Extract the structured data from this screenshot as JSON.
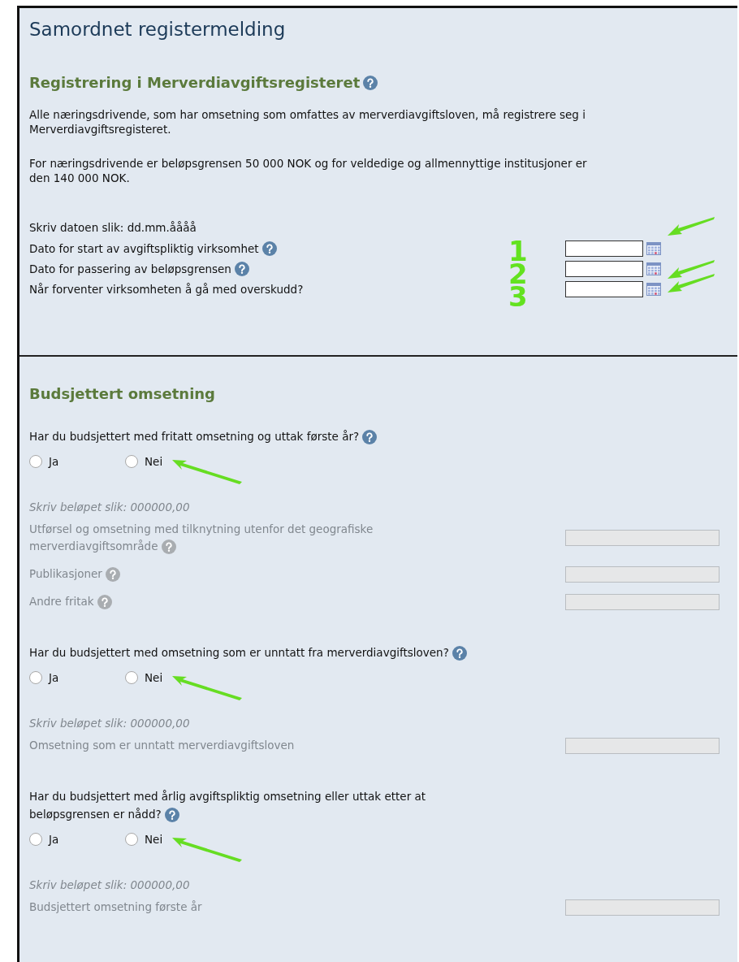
{
  "title": "Samordnet registermelding",
  "registration": {
    "heading": "Registrering i Merverdiavgiftsregisteret",
    "help": true,
    "paragraphs": [
      "Alle næringsdrivende, som har omsetning som omfattes av merverdiavgiftsloven, må registrere seg i Merverdiavgiftsregisteret.",
      "For næringsdrivende er beløpsgrensen 50 000 NOK og for veldedige og allmennyttige institusjoner er den 140 000 NOK."
    ],
    "date_hint": "Skriv datoen slik: dd.mm.åååå",
    "date_fields": [
      {
        "label": "Dato for start av avgiftspliktig virksomhet",
        "help": true,
        "marker": "1",
        "annotated": true
      },
      {
        "label": "Dato for passering av beløpsgrensen",
        "help": true,
        "marker": "2",
        "annotated": true
      },
      {
        "label": "Når forventer virksomheten å gå med overskudd?",
        "help": false,
        "marker": "3",
        "annotated": true
      }
    ]
  },
  "budget": {
    "heading": "Budsjettert omsetning",
    "questions": [
      {
        "text": "Har du budsjettert med fritatt omsetning og uttak første år?",
        "help": true,
        "annotated": true,
        "options": [
          {
            "label": "Ja",
            "selected": false
          },
          {
            "label": "Nei",
            "selected": false
          }
        ],
        "amount_hint": "Skriv beløpet slik: 000000,00",
        "disabled": true,
        "fields": [
          {
            "label": "Utførsel og omsetning med tilknytning utenfor det geografiske merverdiavgiftsområde",
            "help": true
          },
          {
            "label": "Publikasjoner",
            "help": true
          },
          {
            "label": "Andre fritak",
            "help": true
          }
        ]
      },
      {
        "text": "Har du budsjettert med omsetning som er unntatt fra merverdiavgiftsloven?",
        "help": true,
        "annotated": true,
        "options": [
          {
            "label": "Ja",
            "selected": false
          },
          {
            "label": "Nei",
            "selected": false
          }
        ],
        "amount_hint": "Skriv beløpet slik: 000000,00",
        "disabled": true,
        "fields": [
          {
            "label": "Omsetning som er unntatt merverdiavgiftsloven",
            "help": false
          }
        ]
      },
      {
        "text": "Har du budsjettert med årlig avgiftspliktig omsetning eller uttak etter at beløpsgrensen er nådd?",
        "help": true,
        "annotated": true,
        "options": [
          {
            "label": "Ja",
            "selected": false
          },
          {
            "label": "Nei",
            "selected": false
          }
        ],
        "amount_hint": "Skriv beløpet slik: 000000,00",
        "disabled": true,
        "fields": [
          {
            "label": "Budsjettert omsetning første år",
            "help": false
          }
        ]
      }
    ]
  }
}
